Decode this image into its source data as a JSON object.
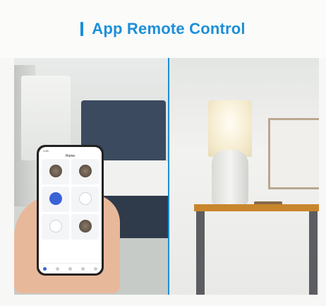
{
  "header": {
    "title": "App Remote Control"
  },
  "phone": {
    "app_title": "Home",
    "status_left": "1:00",
    "status_right": "",
    "devices": [
      {
        "label": "",
        "icon": "camera-photo-icon"
      },
      {
        "label": "",
        "icon": "camera-photo-icon"
      },
      {
        "label": "",
        "icon": "power-icon"
      },
      {
        "label": "",
        "icon": "outlet-icon"
      },
      {
        "label": "",
        "icon": "outlet-icon"
      },
      {
        "label": "",
        "icon": "camera-photo-icon"
      }
    ],
    "tabs": [
      "home-tab-icon",
      "scene-tab-icon",
      "device-tab-icon",
      "profile-tab-icon",
      "settings-tab-icon"
    ]
  },
  "colors": {
    "accent": "#1c8fd9",
    "background": "#f7f7f5"
  }
}
